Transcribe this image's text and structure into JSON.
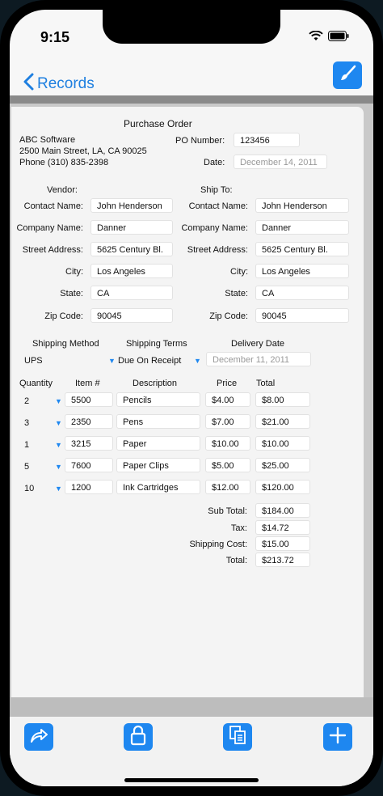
{
  "status": {
    "time": "9:15"
  },
  "nav": {
    "back_label": "Records"
  },
  "form": {
    "title": "Purchase Order",
    "company": {
      "name": "ABC Software",
      "address": "2500 Main Street, LA, CA 90025",
      "phone": "Phone (310) 835-2398"
    },
    "po_label": "PO Number:",
    "po_value": "123456",
    "date_label": "Date:",
    "date_value": "December 14, 2011",
    "vendor_header": "Vendor:",
    "shipto_header": "Ship To:",
    "labels": {
      "contact": "Contact Name:",
      "company": "Company Name:",
      "street": "Street Address:",
      "city": "City:",
      "state": "State:",
      "zip": "Zip Code:"
    },
    "vendor": {
      "contact": "John Henderson",
      "company": "Danner",
      "street": "5625 Century Bl.",
      "city": "Los Angeles",
      "state": "CA",
      "zip": "90045"
    },
    "shipto": {
      "contact": "John Henderson",
      "company": "Danner",
      "street": "5625 Century Bl.",
      "city": "Los Angeles",
      "state": "CA",
      "zip": "90045"
    },
    "shipping": {
      "method_label": "Shipping Method",
      "terms_label": "Shipping Terms",
      "delivery_label": "Delivery Date",
      "method_value": "UPS",
      "terms_value": "Due On Receipt",
      "delivery_value": "December 11, 2011"
    },
    "columns": {
      "quantity": "Quantity",
      "item": "Item #",
      "description": "Description",
      "price": "Price",
      "total": "Total"
    },
    "items": [
      {
        "qty": "2",
        "item": "5500",
        "desc": "Pencils",
        "price": "$4.00",
        "total": "$8.00"
      },
      {
        "qty": "3",
        "item": "2350",
        "desc": "Pens",
        "price": "$7.00",
        "total": "$21.00"
      },
      {
        "qty": "1",
        "item": "3215",
        "desc": "Paper",
        "price": "$10.00",
        "total": "$10.00"
      },
      {
        "qty": "5",
        "item": "7600",
        "desc": "Paper Clips",
        "price": "$5.00",
        "total": "$25.00"
      },
      {
        "qty": "10",
        "item": "1200",
        "desc": "Ink Cartridges",
        "price": "$12.00",
        "total": "$120.00"
      }
    ],
    "summary": {
      "subtotal_label": "Sub Total:",
      "subtotal": "$184.00",
      "tax_label": "Tax:",
      "tax": "$14.72",
      "shipping_label": "Shipping Cost:",
      "shipping": "$15.00",
      "total_label": "Total:",
      "total": "$213.72"
    }
  },
  "toolbar": {
    "icons": [
      "share-icon",
      "lock-icon",
      "copy-icon",
      "plus-icon"
    ]
  },
  "colors": {
    "accent": "#1e87f0",
    "back": "#1e7fe0"
  }
}
